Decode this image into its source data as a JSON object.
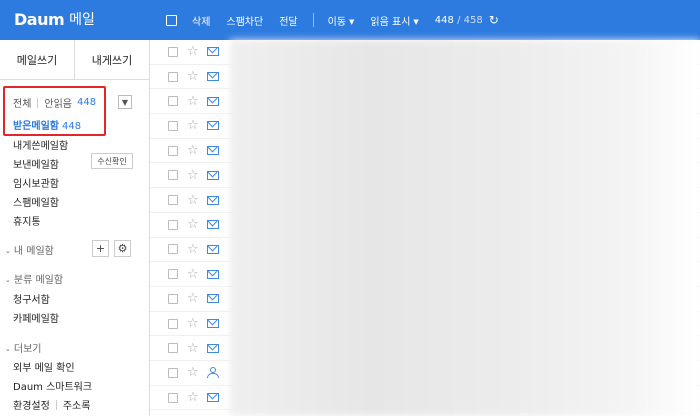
{
  "brand": {
    "logo": "Daum",
    "product": "메일"
  },
  "toolbar": {
    "delete": "삭제",
    "spam_block": "스팸차단",
    "forward": "전달",
    "move": "이동",
    "mark_read": "읽음 표시",
    "count_unread": "448",
    "count_sep": "/",
    "count_total": "458",
    "refresh_icon": "refresh-icon"
  },
  "compose": {
    "write": "메일쓰기",
    "to_me": "내게쓰기"
  },
  "filter": {
    "all": "전체",
    "unread": "안읽음",
    "unread_count": "448"
  },
  "folders": {
    "inbox": {
      "label": "받은메일함",
      "count": "448"
    },
    "sent_to_me": "내게쓴메일함",
    "sent": "보낸메일함",
    "receipt_check": "수신확인",
    "drafts": "임시보관함",
    "spam": "스팸메일함",
    "trash": "휴지통"
  },
  "my_mailbox": {
    "label": "내 메일함"
  },
  "category": {
    "label": "분류 메일함",
    "items": [
      "청구서함",
      "카페메일함"
    ]
  },
  "more": {
    "label": "더보기",
    "external": "외부 메일 확인",
    "smartwork": "Daum 스마트워크",
    "settings": "환경설정",
    "contacts": "주소록"
  },
  "mail_rows": [
    {
      "icon": "envelope-icon"
    },
    {
      "icon": "envelope-icon"
    },
    {
      "icon": "envelope-icon"
    },
    {
      "icon": "envelope-icon"
    },
    {
      "icon": "envelope-icon"
    },
    {
      "icon": "envelope-icon"
    },
    {
      "icon": "envelope-icon"
    },
    {
      "icon": "envelope-icon"
    },
    {
      "icon": "envelope-icon"
    },
    {
      "icon": "envelope-icon"
    },
    {
      "icon": "envelope-icon"
    },
    {
      "icon": "envelope-icon"
    },
    {
      "icon": "envelope-icon"
    },
    {
      "icon": "person-icon"
    },
    {
      "icon": "envelope-icon"
    }
  ],
  "colors": {
    "accent": "#2e7be0",
    "highlight": "#e2262a"
  }
}
